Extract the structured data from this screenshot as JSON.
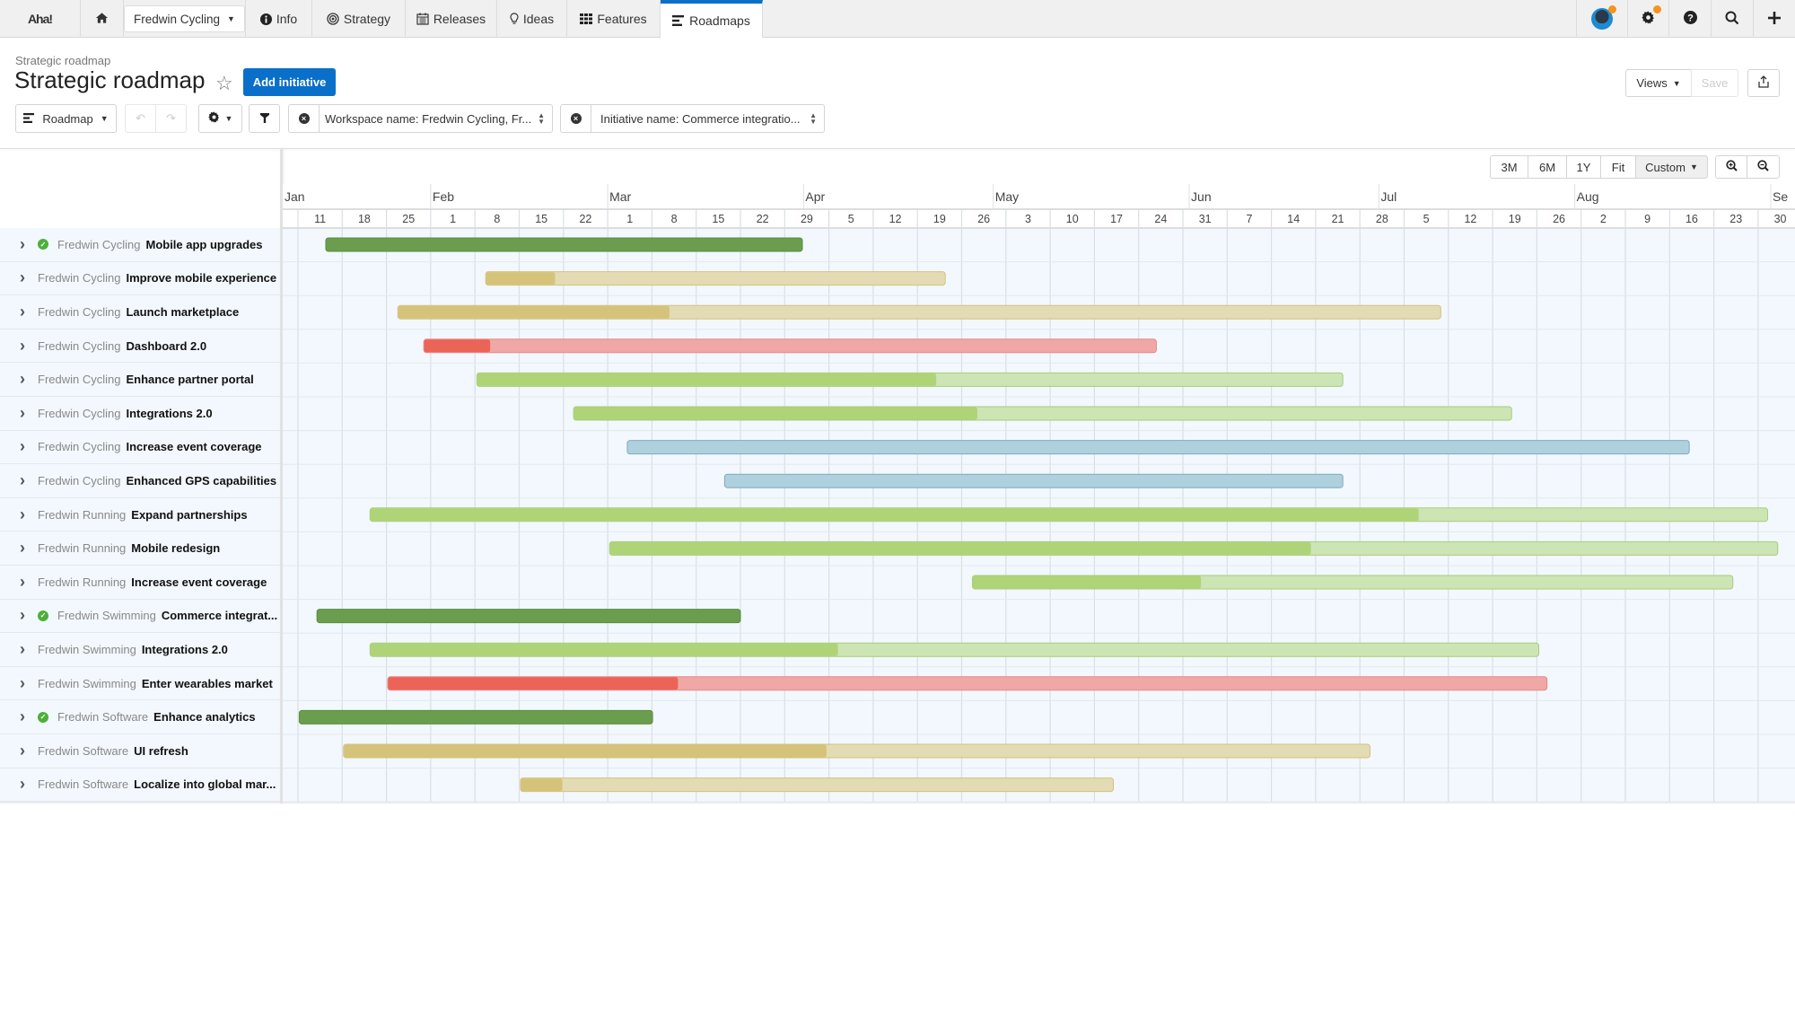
{
  "nav": {
    "logo": "Aha!",
    "workspace": "Fredwin Cycling",
    "items": [
      {
        "label": "Info",
        "icon": "info-icon"
      },
      {
        "label": "Strategy",
        "icon": "strategy-icon"
      },
      {
        "label": "Releases",
        "icon": "calendar-icon"
      },
      {
        "label": "Ideas",
        "icon": "lightbulb-icon"
      },
      {
        "label": "Features",
        "icon": "grid-icon"
      },
      {
        "label": "Roadmaps",
        "icon": "roadmap-icon",
        "active": true
      }
    ],
    "right_icons": [
      "avatar",
      "gear-icon",
      "help-icon",
      "search-icon",
      "plus-icon"
    ]
  },
  "page": {
    "breadcrumb": "Strategic roadmap",
    "title": "Strategic roadmap",
    "add_button": "Add initiative",
    "views_button": "Views",
    "save_button": "Save"
  },
  "toolbar": {
    "roadmap_button": "Roadmap",
    "filter1": "Workspace name: Fredwin Cycling, Fr...",
    "filter2": "Initiative name: Commerce integratio..."
  },
  "zoom_controls": {
    "ranges": [
      "3M",
      "6M",
      "1Y",
      "Fit",
      "Custom"
    ],
    "active": "Custom"
  },
  "timeline": {
    "months": [
      {
        "label": "Jan",
        "day": -3
      },
      {
        "label": "Feb",
        "day": 21
      },
      {
        "label": "Mar",
        "day": 49
      },
      {
        "label": "Apr",
        "day": 80
      },
      {
        "label": "May",
        "day": 110
      },
      {
        "label": "Jun",
        "day": 141
      },
      {
        "label": "Jul",
        "day": 171
      },
      {
        "label": "Aug",
        "day": 202
      },
      {
        "label": "Se",
        "day": 233
      }
    ],
    "weeks": [
      "11",
      "18",
      "25",
      "1",
      "8",
      "15",
      "22",
      "1",
      "8",
      "15",
      "22",
      "29",
      "5",
      "12",
      "19",
      "26",
      "3",
      "10",
      "17",
      "24",
      "31",
      "7",
      "14",
      "21",
      "28",
      "5",
      "12",
      "19",
      "26",
      "2",
      "9",
      "16",
      "23",
      "30"
    ]
  },
  "colors": {
    "dark_green": "#6a9e4e",
    "dark_green_border": "#5a8e3e",
    "green": "#afd477",
    "green_light": "#cde5b5",
    "yellow": "#d6c37a",
    "yellow_light": "#e3dbb4",
    "red": "#ec6357",
    "red_light": "#efa8a5",
    "blue": "#afd0dd",
    "blue_border": "#7eabbe"
  },
  "initiatives": [
    {
      "workspace": "Fredwin Cycling",
      "name": "Mobile app upgrades",
      "completed": true,
      "start": "Jan 15",
      "end": "Mar 31",
      "s": 4.4,
      "e": 79.8,
      "progress": 100,
      "color": "dark_green"
    },
    {
      "workspace": "Fredwin Cycling",
      "name": "Improve mobile experience",
      "completed": false,
      "start": "Feb 9",
      "end": "Apr 23",
      "s": 29.7,
      "e": 102.4,
      "progress": 15,
      "color": "yellow"
    },
    {
      "workspace": "Fredwin Cycling",
      "name": "Launch marketplace",
      "completed": false,
      "start": "Jan 27",
      "end": "Jul 10",
      "s": 15.8,
      "e": 180.8,
      "progress": 26,
      "color": "yellow"
    },
    {
      "workspace": "Fredwin Cycling",
      "name": "Dashboard 2.0",
      "completed": false,
      "start": "Jan 31",
      "end": "May 26",
      "s": 19.9,
      "e": 135.8,
      "progress": 9,
      "color": "red"
    },
    {
      "workspace": "Fredwin Cycling",
      "name": "Enhance partner portal",
      "completed": false,
      "start": "Feb 8",
      "end": "Jun 24",
      "s": 28.3,
      "e": 165.3,
      "progress": 53,
      "color": "green"
    },
    {
      "workspace": "Fredwin Cycling",
      "name": "Integrations 2.0",
      "completed": false,
      "start": "Feb 23",
      "end": "Jul 22",
      "s": 43.6,
      "e": 192.0,
      "progress": 43,
      "color": "green"
    },
    {
      "workspace": "Fredwin Cycling",
      "name": "Increase event coverage",
      "completed": false,
      "start": "Mar 3",
      "end": "Aug 19",
      "s": 52.1,
      "e": 220.1,
      "progress": null,
      "color": "blue"
    },
    {
      "workspace": "Fredwin Cycling",
      "name": "Enhanced GPS capabilities",
      "completed": false,
      "start": "Mar 18",
      "end": "Jun 24",
      "s": 67.5,
      "e": 165.3,
      "progress": null,
      "color": "blue"
    },
    {
      "workspace": "Fredwin Running",
      "name": "Expand partnerships",
      "completed": false,
      "start": "Jan 22",
      "end": "Aug 31",
      "s": 11.4,
      "e": 232.5,
      "progress": 75,
      "color": "green"
    },
    {
      "workspace": "Fredwin Running",
      "name": "Mobile redesign",
      "completed": false,
      "start": "Mar 1",
      "end": "Sep 2",
      "s": 49.3,
      "e": 234.1,
      "progress": 60,
      "color": "green"
    },
    {
      "workspace": "Fredwin Running",
      "name": "Increase event coverage",
      "completed": false,
      "start": "Apr 27",
      "end": "Aug 26",
      "s": 106.7,
      "e": 227.0,
      "progress": 30,
      "color": "green"
    },
    {
      "workspace": "Fredwin Swimming",
      "name": "Commerce integrat...",
      "completed": true,
      "start": "Jan 14",
      "end": "Mar 22",
      "s": 3.0,
      "e": 70.0,
      "progress": 100,
      "color": "dark_green"
    },
    {
      "workspace": "Fredwin Swimming",
      "name": "Integrations 2.0",
      "completed": false,
      "start": "Jan 22",
      "end": "Jul 26",
      "s": 11.4,
      "e": 196.3,
      "progress": 40,
      "color": "green"
    },
    {
      "workspace": "Fredwin Swimming",
      "name": "Enter wearables market",
      "completed": false,
      "start": "Jan 25",
      "end": "Jul 27",
      "s": 14.2,
      "e": 197.6,
      "progress": 25,
      "color": "red"
    },
    {
      "workspace": "Fredwin Software",
      "name": "Enhance analytics",
      "completed": true,
      "start": "Jan 11",
      "end": "Mar 8",
      "s": 0.2,
      "e": 56.1,
      "progress": 100,
      "color": "dark_green"
    },
    {
      "workspace": "Fredwin Software",
      "name": "UI refresh",
      "completed": false,
      "start": "Jan 18",
      "end": "Jun 29",
      "s": 7.2,
      "e": 169.6,
      "progress": 47,
      "color": "yellow"
    },
    {
      "workspace": "Fredwin Software",
      "name": "Localize into global mar...",
      "completed": false,
      "start": "Feb 15",
      "end": "May 20",
      "s": 35.2,
      "e": 129.0,
      "progress": 7,
      "color": "yellow"
    }
  ]
}
